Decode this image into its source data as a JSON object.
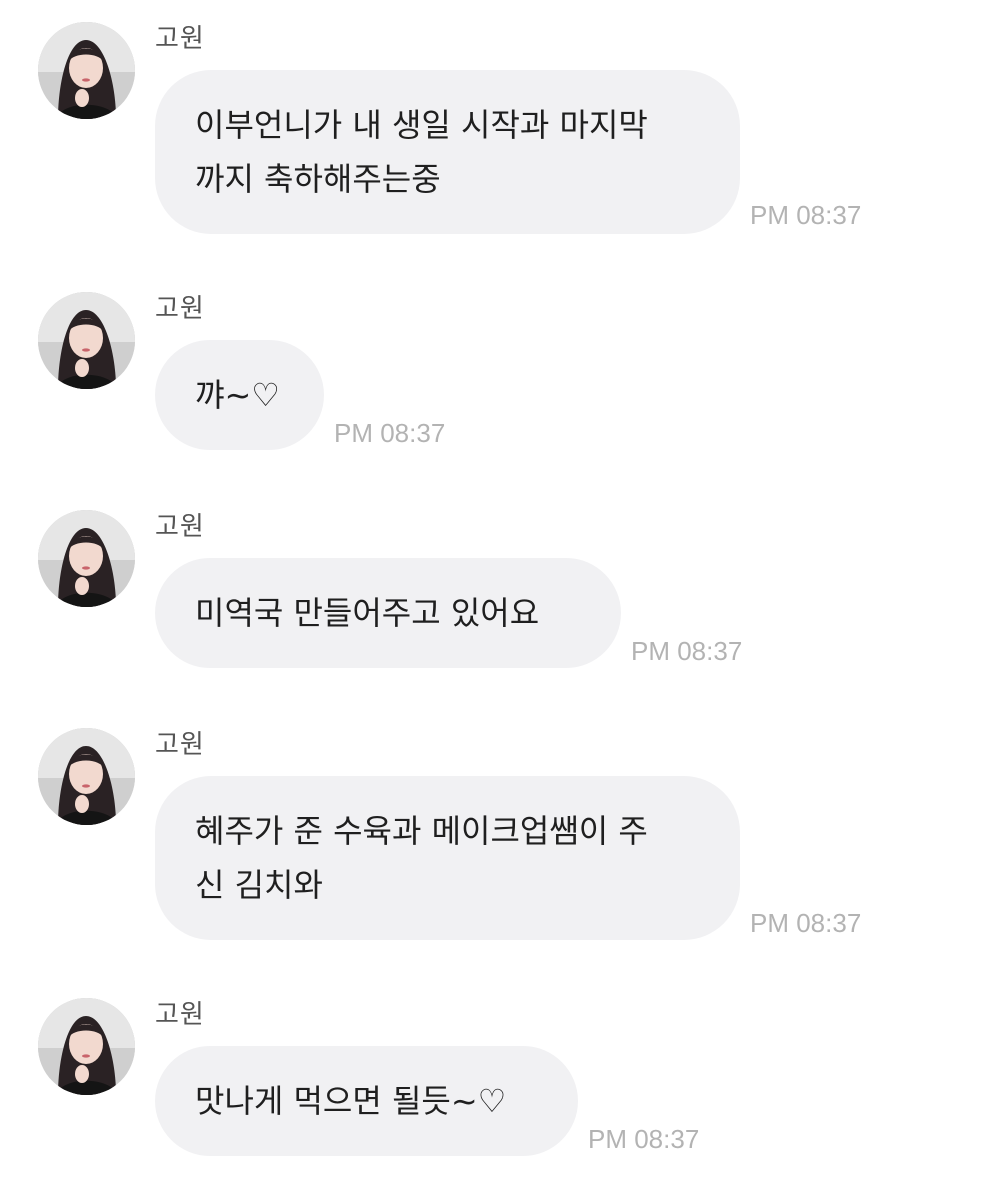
{
  "messages": [
    {
      "sender": "고원",
      "lines": [
        "이부언니가 내 생일 시작과 마지막",
        "까지 축하해주는중"
      ],
      "time": "PM 08:37"
    },
    {
      "sender": "고원",
      "lines": [
        "꺄~♡"
      ],
      "time": "PM 08:37"
    },
    {
      "sender": "고원",
      "lines": [
        "미역국 만들어주고 있어요"
      ],
      "time": "PM 08:37"
    },
    {
      "sender": "고원",
      "lines": [
        "혜주가 준 수육과 메이크업쌤이 주",
        "신 김치와"
      ],
      "time": "PM 08:37"
    },
    {
      "sender": "고원",
      "lines": [
        "맛나게 먹으면 될듯~♡"
      ],
      "time": "PM 08:37"
    }
  ],
  "colors": {
    "bubble_bg": "#f1f1f3",
    "message_text": "#1f1f1f",
    "sender_text": "#555555",
    "time_text": "#b3b3b3"
  },
  "icons": {
    "avatar": "profile-photo"
  }
}
